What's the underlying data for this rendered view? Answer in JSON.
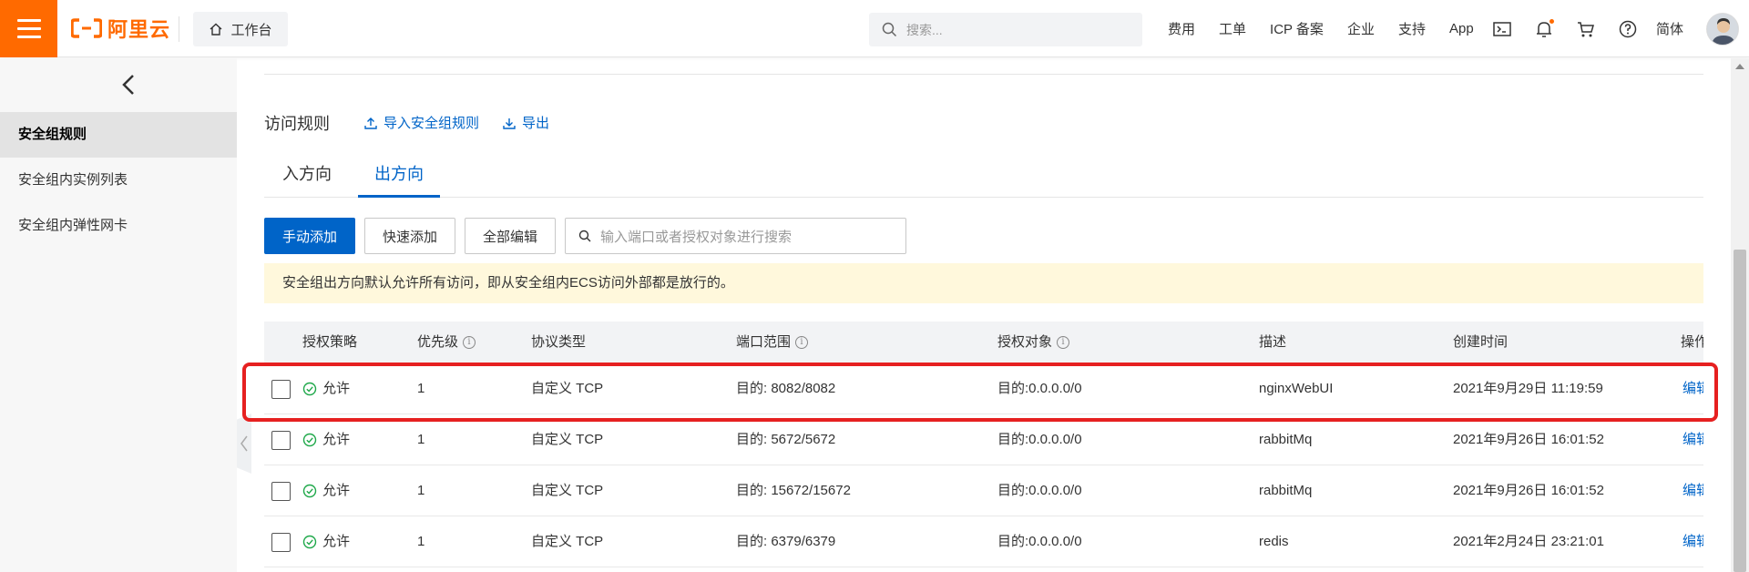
{
  "header": {
    "logo_text": "阿里云",
    "workbench_label": "工作台",
    "search_placeholder": "搜索...",
    "links": [
      "费用",
      "工单",
      "ICP 备案",
      "企业",
      "支持",
      "App"
    ],
    "lang_label": "简体",
    "brand_color": "#ff6a00"
  },
  "sidebar": {
    "items": [
      {
        "label": "安全组规则",
        "active": true
      },
      {
        "label": "安全组内实例列表",
        "active": false
      },
      {
        "label": "安全组内弹性网卡",
        "active": false
      }
    ]
  },
  "main": {
    "section_title": "访问规则",
    "import_label": "导入安全组规则",
    "export_label": "导出",
    "tabs": [
      {
        "label": "入方向",
        "active": false
      },
      {
        "label": "出方向",
        "active": true
      }
    ],
    "buttons": {
      "manual_add": "手动添加",
      "quick_add": "快速添加",
      "edit_all": "全部编辑"
    },
    "filter_placeholder": "输入端口或者授权对象进行搜索",
    "notice": "安全组出方向默认允许所有访问，即从安全组内ECS访问外部都是放行的。",
    "accent_color": "#0064c8",
    "table": {
      "headers": {
        "policy": "授权策略",
        "priority": "优先级",
        "protocol": "协议类型",
        "port": "端口范围",
        "target": "授权对象",
        "desc": "描述",
        "created": "创建时间",
        "action": "操作"
      },
      "rows": [
        {
          "policy": "允许",
          "priority": "1",
          "protocol": "自定义 TCP",
          "port": "目的: 8082/8082",
          "target": "目的:0.0.0.0/0",
          "desc": "nginxWebUI",
          "created": "2021年9月29日 11:19:59",
          "action": "编辑"
        },
        {
          "policy": "允许",
          "priority": "1",
          "protocol": "自定义 TCP",
          "port": "目的: 5672/5672",
          "target": "目的:0.0.0.0/0",
          "desc": "rabbitMq",
          "created": "2021年9月26日 16:01:52",
          "action": "编辑"
        },
        {
          "policy": "允许",
          "priority": "1",
          "protocol": "自定义 TCP",
          "port": "目的: 15672/15672",
          "target": "目的:0.0.0.0/0",
          "desc": "rabbitMq",
          "created": "2021年9月26日 16:01:52",
          "action": "编辑"
        },
        {
          "policy": "允许",
          "priority": "1",
          "protocol": "自定义 TCP",
          "port": "目的: 6379/6379",
          "target": "目的:0.0.0.0/0",
          "desc": "redis",
          "created": "2021年2月24日 23:21:01",
          "action": "编辑"
        }
      ]
    }
  }
}
